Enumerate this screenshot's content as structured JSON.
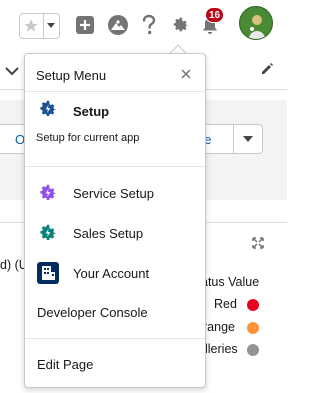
{
  "topbar": {
    "notifications_count": "16",
    "icons": [
      "star-icon",
      "chevron-down-icon",
      "add-icon",
      "trailhead-icon",
      "help-icon",
      "gear-icon",
      "bell-icon",
      "avatar"
    ]
  },
  "background": {
    "left_button_text": "O",
    "right_button_text": "pe",
    "row_left_text": "d) (U",
    "status_header": "atus Value",
    "status_rows": [
      {
        "label": "Red",
        "color": "#ea001e"
      },
      {
        "label": "range",
        "color": "#fe9339"
      },
      {
        "label": "lleries",
        "color": "#939393"
      }
    ]
  },
  "menu": {
    "title": "Setup Menu",
    "setup_label": "Setup",
    "setup_subtitle": "Setup for current app",
    "items": [
      {
        "label": "Service Setup",
        "icon": "service-setup-icon",
        "color": "#9050e9"
      },
      {
        "label": "Sales Setup",
        "icon": "sales-setup-icon",
        "color": "#0d9dda"
      },
      {
        "label": "Your Account",
        "icon": "your-account-icon",
        "color": "#032d60"
      }
    ],
    "developer_console_label": "Developer Console",
    "edit_page_label": "Edit Page"
  },
  "colors": {
    "setup_gear": "#1b5297",
    "badge": "#ba0517",
    "link": "#0b5cab"
  }
}
